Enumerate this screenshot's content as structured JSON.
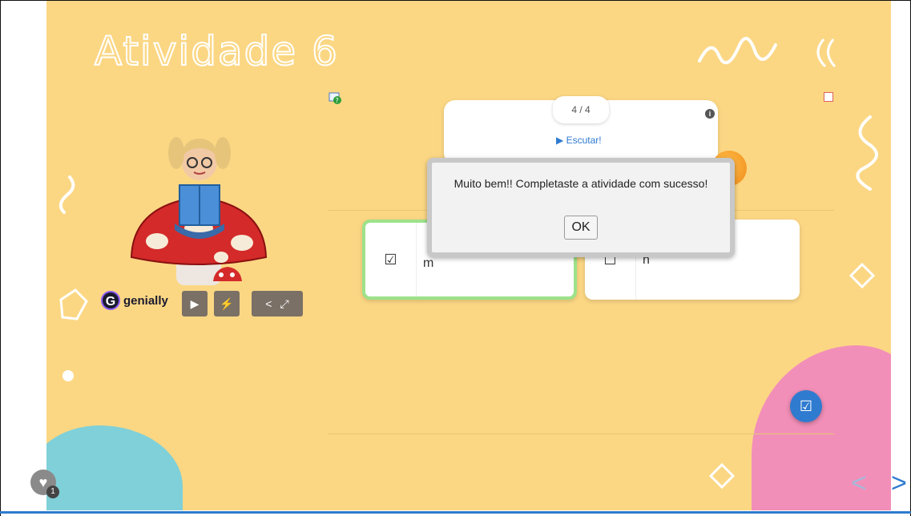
{
  "slide": {
    "title": "Atividade 6",
    "background_color": "#fbd784"
  },
  "embed": {
    "brand": "genially",
    "controls": [
      "play-icon",
      "mute-icon",
      "share-icon",
      "fullscreen-icon"
    ]
  },
  "activity": {
    "counter": "4 / 4",
    "listen_label": "▶ Escutar!",
    "options": [
      {
        "label": "m",
        "checked": true
      },
      {
        "label": "n",
        "checked": false
      }
    ]
  },
  "dialog": {
    "message": "Muito bem!! Completaste a atividade com sucesso!",
    "ok_label": "OK"
  },
  "footer": {
    "likes_count": "1"
  },
  "colors": {
    "accent_blue": "#2f7bd0",
    "correct_green": "#9de28a",
    "pink": "#f28fb8",
    "teal": "#7fd0d8"
  }
}
